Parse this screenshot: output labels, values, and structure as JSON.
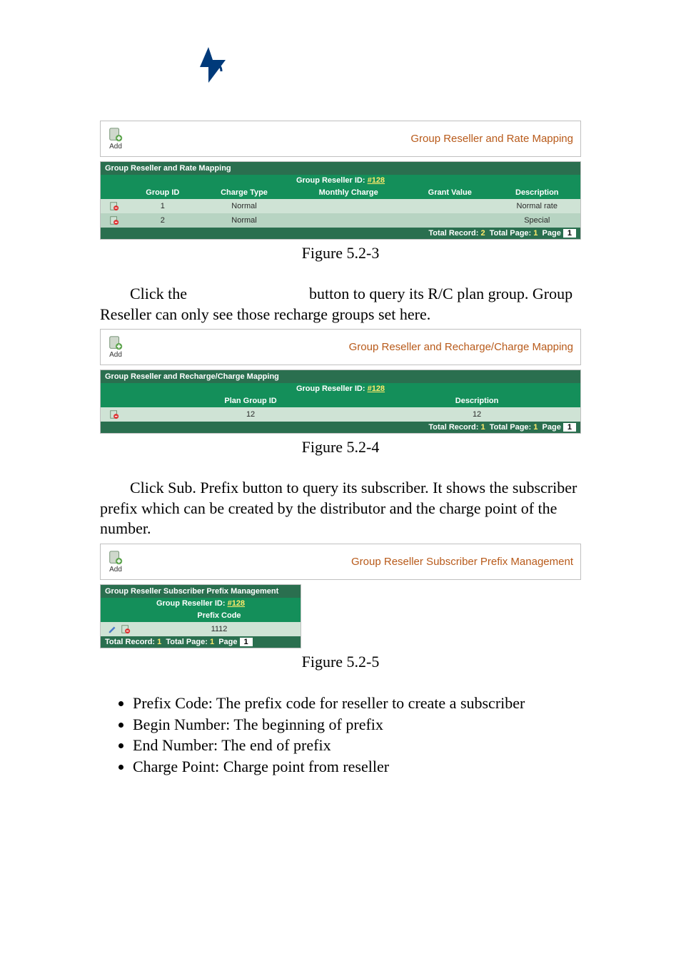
{
  "logo_alt": "logo",
  "panel1": {
    "add_label": "Add",
    "title": "Group Reseller and Rate Mapping",
    "section_head": "Group Reseller and Rate Mapping",
    "reseller_label": "Group Reseller ID:",
    "reseller_id": "#128",
    "cols": [
      "Group ID",
      "Charge Type",
      "Monthly Charge",
      "Grant Value",
      "Description"
    ],
    "rows": [
      {
        "group_id": "1",
        "charge_type": "Normal",
        "monthly": "",
        "grant": "",
        "desc": "Normal rate"
      },
      {
        "group_id": "2",
        "charge_type": "Normal",
        "monthly": "",
        "grant": "",
        "desc": "Special"
      }
    ],
    "footer": {
      "records_label": "Total Record:",
      "records": "2",
      "pages_label": "Total Page:",
      "pages": "1",
      "page_label": "Page",
      "page": "1"
    }
  },
  "fig1": "Figure 5.2-3",
  "para1a": "Click the",
  "para1b": "button to query its R/C plan group. Group Reseller can only see those recharge groups set here.",
  "panel2": {
    "add_label": "Add",
    "title": "Group Reseller and Recharge/Charge Mapping",
    "section_head": "Group Reseller and Recharge/Charge Mapping",
    "reseller_label": "Group Reseller ID:",
    "reseller_id": "#128",
    "cols": [
      "Plan Group ID",
      "Description"
    ],
    "rows": [
      {
        "plan_group": "12",
        "desc": "12"
      }
    ],
    "footer": {
      "records_label": "Total Record:",
      "records": "1",
      "pages_label": "Total Page:",
      "pages": "1",
      "page_label": "Page",
      "page": "1"
    }
  },
  "fig2": "Figure 5.2-4",
  "para2": "Click Sub. Prefix button to query its subscriber. It shows the subscriber prefix which can be created by the distributor and the charge point of the number.",
  "panel3": {
    "add_label": "Add",
    "title": "Group Reseller Subscriber Prefix Management",
    "section_head": "Group Reseller Subscriber Prefix Management",
    "reseller_label": "Group Reseller ID:",
    "reseller_id": "#128",
    "cols": [
      "Prefix Code"
    ],
    "rows": [
      {
        "prefix": "1112"
      }
    ],
    "footer": {
      "records_label": "Total Record:",
      "records": "1",
      "pages_label": "Total Page:",
      "pages": "1",
      "page_label": "Page",
      "page": "1"
    }
  },
  "fig3": "Figure 5.2-5",
  "bullets": [
    "Prefix Code: The prefix code for reseller to create a subscriber",
    "Begin Number: The beginning of prefix",
    "End Number: The end of prefix",
    "Charge Point: Charge point from reseller"
  ]
}
